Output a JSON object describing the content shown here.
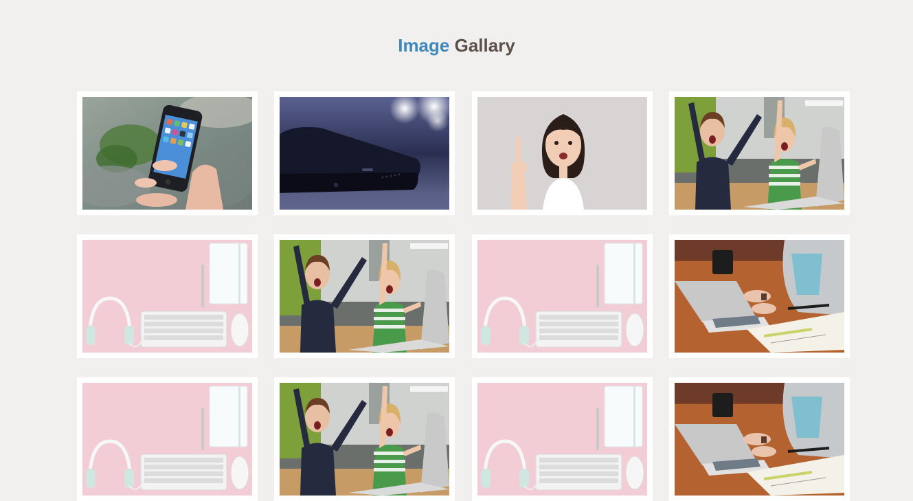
{
  "header": {
    "title_accent": "Image",
    "title_rest": "Gallary"
  },
  "colors": {
    "background": "#f1f0ef",
    "title_accent": "#3f88b9",
    "title_rest": "#5d504a",
    "card": "#ffffff"
  },
  "gallery": {
    "items": [
      {
        "subject": "hand-holding-smartphone"
      },
      {
        "subject": "smartphone-closeup-dark"
      },
      {
        "subject": "girl-pointing-up"
      },
      {
        "subject": "kids-cheering-laptop"
      },
      {
        "subject": "pink-desk-keyboard-headphones"
      },
      {
        "subject": "kids-cheering-laptop"
      },
      {
        "subject": "pink-desk-keyboard-headphones"
      },
      {
        "subject": "person-typing-laptop"
      },
      {
        "subject": "pink-desk-keyboard-headphones"
      },
      {
        "subject": "kids-cheering-laptop"
      },
      {
        "subject": "pink-desk-keyboard-headphones"
      },
      {
        "subject": "person-typing-laptop"
      }
    ]
  }
}
